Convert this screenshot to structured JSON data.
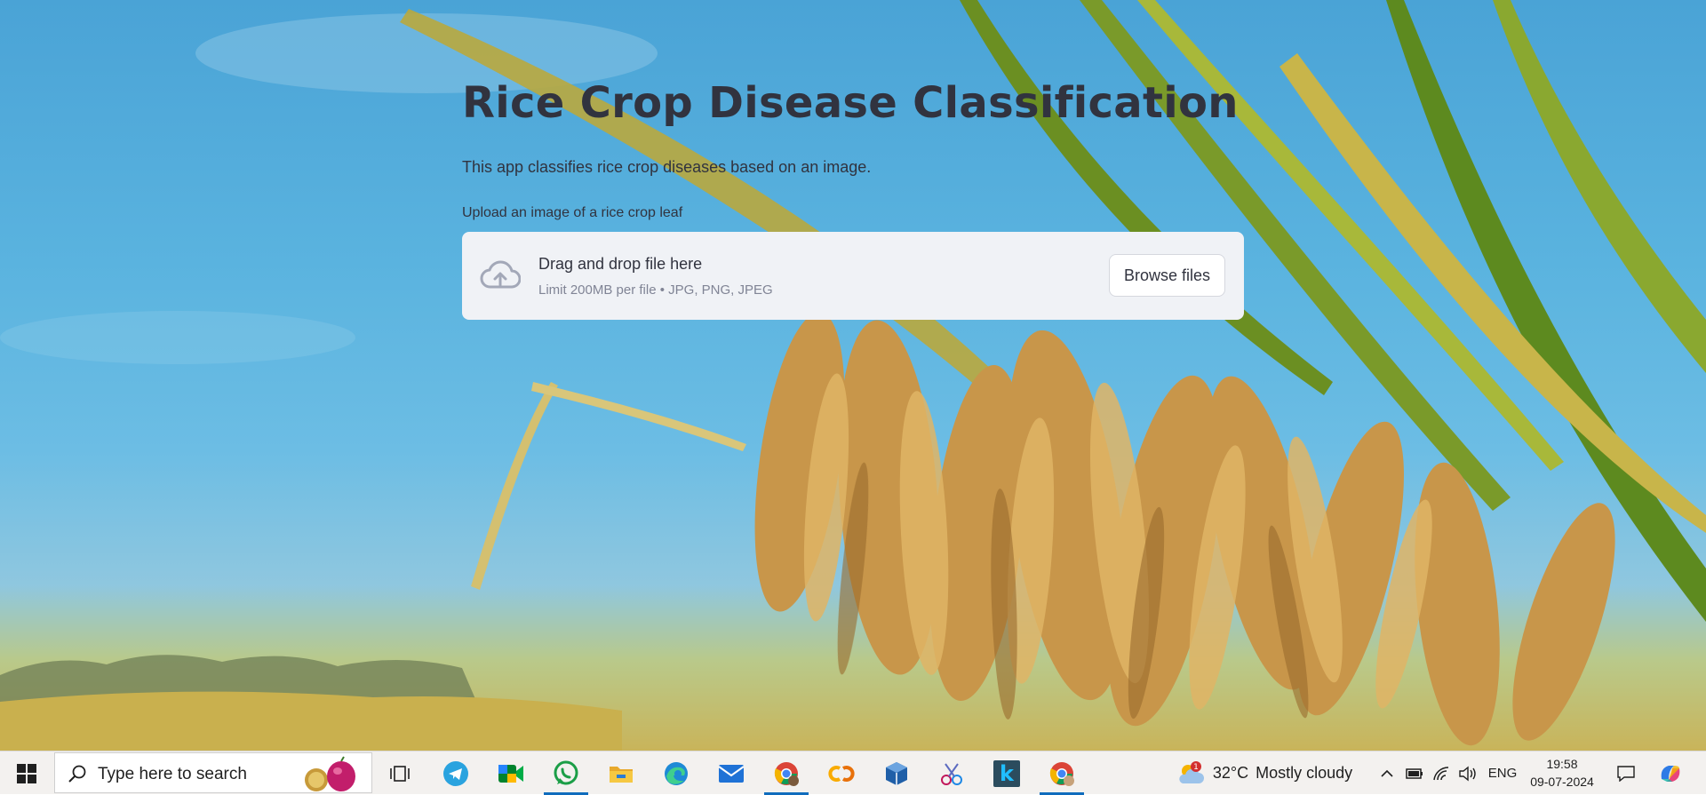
{
  "app": {
    "title": "Rice Crop Disease Classification",
    "description": "This app classifies rice crop diseases based on an image.",
    "uploader": {
      "label": "Upload an image of a rice crop leaf",
      "drag_text": "Drag and drop file here",
      "limit_text": "Limit 200MB per file • JPG, PNG, JPEG",
      "browse_label": "Browse files"
    }
  },
  "taskbar": {
    "search_placeholder": "Type here to search",
    "apps": [
      {
        "name": "task-view",
        "icon": "task-view-icon"
      },
      {
        "name": "telegram",
        "icon": "telegram-icon"
      },
      {
        "name": "google-meet",
        "icon": "google-meet-icon"
      },
      {
        "name": "whatsapp",
        "icon": "whatsapp-icon",
        "active": true
      },
      {
        "name": "file-explorer",
        "icon": "folder-icon"
      },
      {
        "name": "edge",
        "icon": "edge-icon"
      },
      {
        "name": "mail",
        "icon": "mail-icon"
      },
      {
        "name": "chrome-profile",
        "icon": "chrome-icon",
        "active": true
      },
      {
        "name": "colab",
        "icon": "colab-icon"
      },
      {
        "name": "virtualbox",
        "icon": "virtualbox-icon"
      },
      {
        "name": "snipping",
        "icon": "snipping-tool-icon"
      },
      {
        "name": "kaggle",
        "icon": "kaggle-icon"
      },
      {
        "name": "chrome",
        "icon": "chrome-icon",
        "active": true
      }
    ],
    "weather": {
      "temp": "32°C",
      "condition": "Mostly cloudy",
      "badge": "1"
    },
    "language": "ENG",
    "time": "19:58",
    "date": "09-07-2024"
  },
  "colors": {
    "title_text": "#31333f",
    "dropzone_bg": "#f0f2f6",
    "taskbar_bg": "#f3f1ef",
    "active_indicator": "#0f6cbd"
  }
}
